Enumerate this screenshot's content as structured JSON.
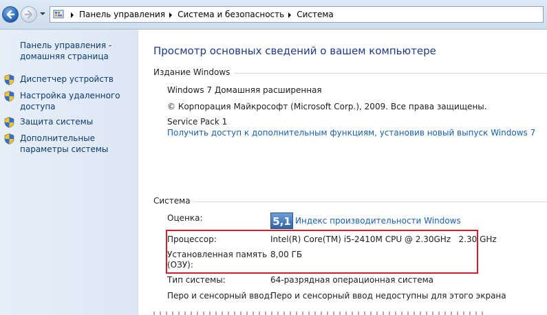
{
  "address_bar": {
    "breadcrumbs": [
      "Панель управления",
      "Система и безопасность",
      "Система"
    ]
  },
  "sidebar": {
    "home_link": "Панель управления - домашняя страница",
    "items": [
      {
        "label": "Диспетчер устройств",
        "icon": "uac-shield-icon"
      },
      {
        "label": "Настройка удаленного доступа",
        "icon": "uac-shield-icon"
      },
      {
        "label": "Защита системы",
        "icon": "uac-shield-icon"
      },
      {
        "label": "Дополнительные параметры системы",
        "icon": "uac-shield-icon"
      }
    ]
  },
  "main": {
    "title": "Просмотр основных сведений о вашем компьютере",
    "edition": {
      "heading": "Издание Windows",
      "name": "Windows 7 Домашняя расширенная",
      "copyright": "© Корпорация Майкрософт (Microsoft Corp.), 2009. Все права защищены.",
      "service_pack": "Service Pack 1",
      "upgrade_link": "Получить доступ к дополнительным функциям, установив новый выпуск Windows 7"
    },
    "system": {
      "heading": "Система",
      "rating_label": "Оценка:",
      "rating_score": "5,1",
      "rating_link": "Индекс производительности Windows",
      "processor_label": "Процессор:",
      "processor_value": "Intel(R) Core(TM) i5-2410M CPU @ 2.30GHz   2.30 GHz",
      "memory_label_line1": "Установленная память",
      "memory_label_line2": "(ОЗУ):",
      "memory_value": "8,00 ГБ",
      "type_label": "Тип системы:",
      "type_value": "64-разрядная операционная система",
      "pen_label": "Перо и сенсорный ввод:",
      "pen_value": "Перо и сенсорный ввод недоступны для этого экрана"
    }
  },
  "colors": {
    "highlight_border": "#cc1f2d",
    "link": "#1660b5",
    "title": "#1e3a8a"
  }
}
